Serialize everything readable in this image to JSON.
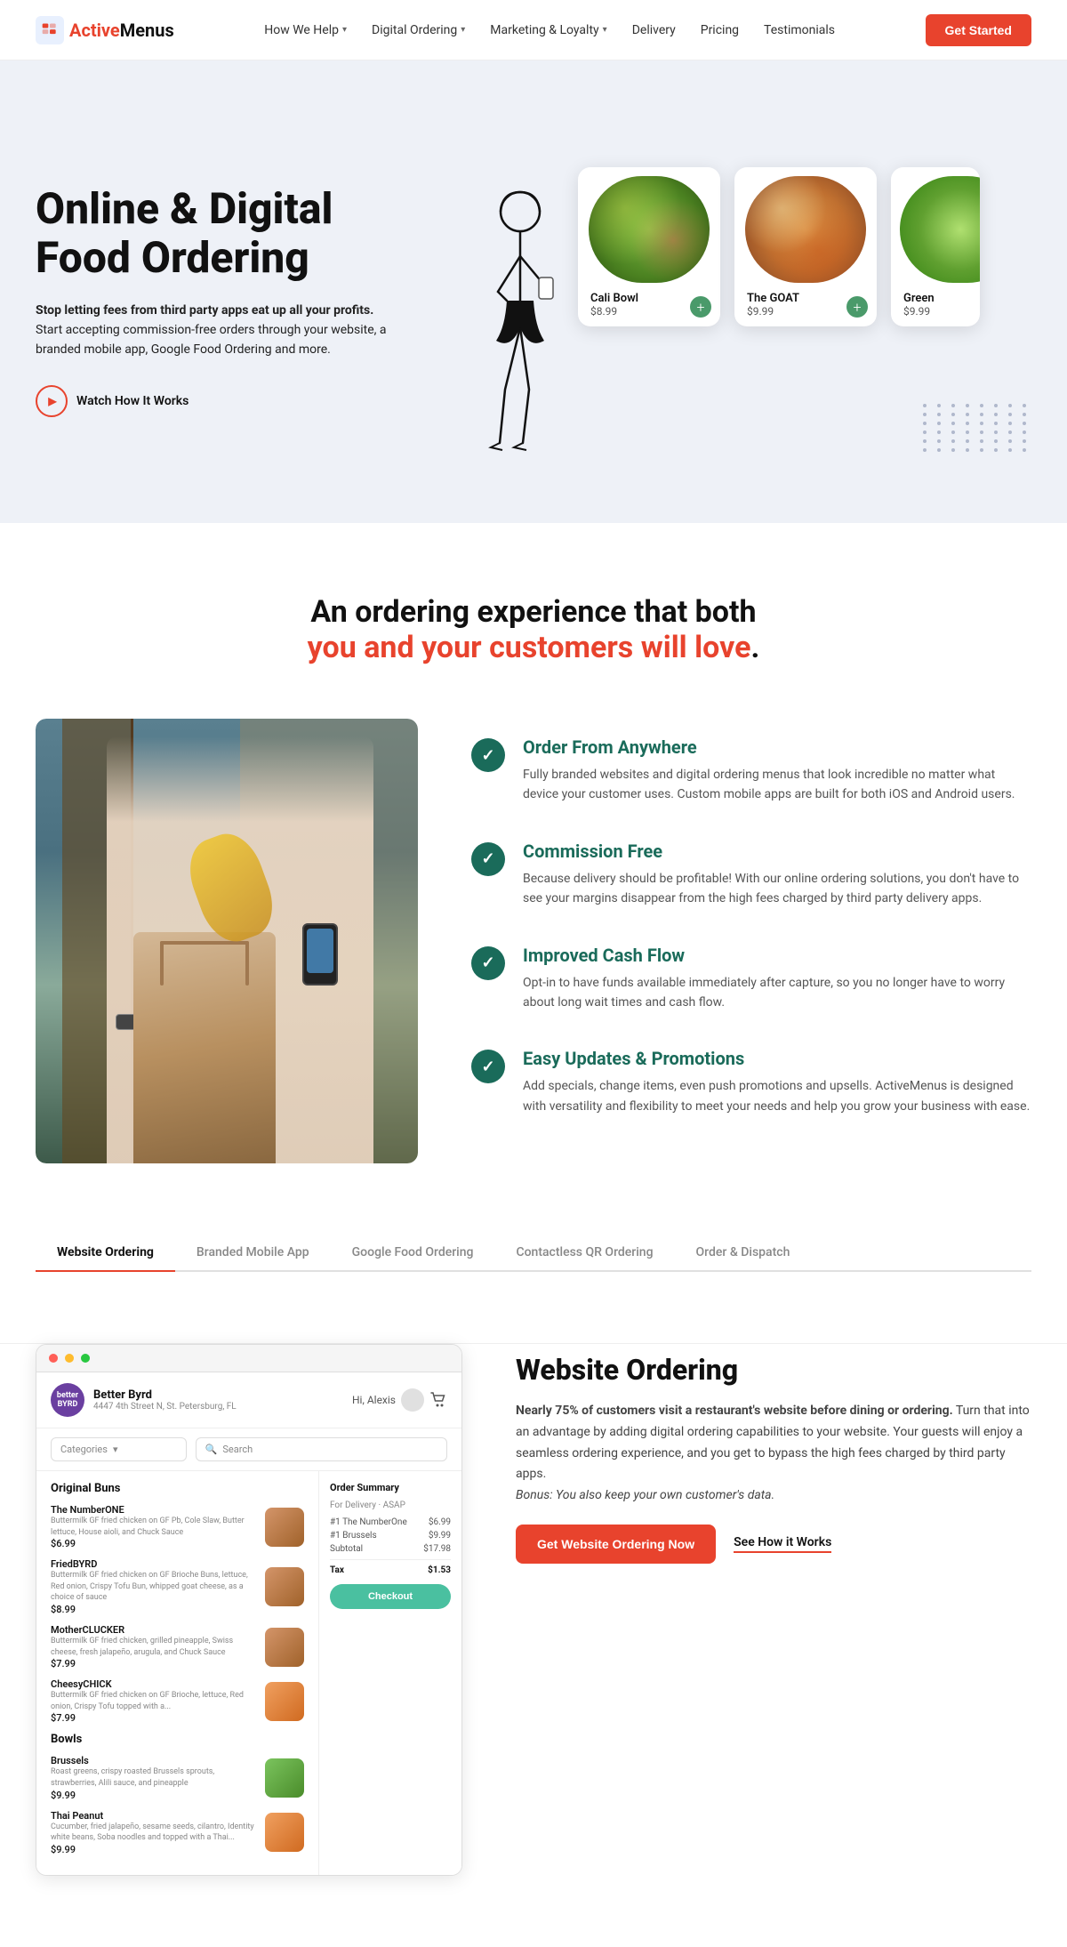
{
  "nav": {
    "logo_active": "Active",
    "logo_rest": "Menus",
    "links": [
      {
        "id": "how-we-help",
        "label": "How We Help",
        "has_dropdown": true
      },
      {
        "id": "digital-ordering",
        "label": "Digital Ordering",
        "has_dropdown": true
      },
      {
        "id": "marketing-loyalty",
        "label": "Marketing & Loyalty",
        "has_dropdown": true
      },
      {
        "id": "delivery",
        "label": "Delivery",
        "has_dropdown": false
      },
      {
        "id": "pricing",
        "label": "Pricing",
        "has_dropdown": false
      },
      {
        "id": "testimonials",
        "label": "Testimonials",
        "has_dropdown": false
      }
    ],
    "cta_label": "Get Started"
  },
  "hero": {
    "title": "Online & Digital Food Ordering",
    "subtitle_bold": "Stop letting fees from third party apps eat up all your profits.",
    "subtitle_normal": "Start accepting commission-free orders through your website, a branded mobile app, Google Food Ordering and more.",
    "watch_label": "Watch How It Works",
    "food_items": [
      {
        "name": "Cali Bowl",
        "price": "$8.99"
      },
      {
        "name": "The GOAT",
        "price": "$9.99"
      },
      {
        "name": "Green",
        "price": "$9.99"
      }
    ]
  },
  "tagline": {
    "line1": "An ordering experience that both",
    "line2": "you and your customers will love",
    "dot": "."
  },
  "features": {
    "items": [
      {
        "id": "order-anywhere",
        "title": "Order From Anywhere",
        "desc": "Fully branded websites and digital ordering menus that look incredible no matter what device your customer uses. Custom mobile apps are built for both iOS and Android users."
      },
      {
        "id": "commission-free",
        "title": "Commission Free",
        "desc": "Because delivery should be profitable! With our online ordering solutions, you don't have to see your margins disappear from the high fees charged by third party delivery apps."
      },
      {
        "id": "improved-cash-flow",
        "title": "Improved Cash Flow",
        "desc": "Opt-in to have funds available immediately after capture, so you no longer have to worry about long wait times and cash flow."
      },
      {
        "id": "easy-updates",
        "title": "Easy Updates & Promotions",
        "desc": "Add specials, change items, even push promotions and upsells. ActiveMenus is designed with versatility and flexibility to meet your needs and help you grow your business with ease."
      }
    ]
  },
  "tabs": {
    "items": [
      {
        "id": "website-ordering",
        "label": "Website Ordering",
        "active": true
      },
      {
        "id": "branded-mobile-app",
        "label": "Branded Mobile App",
        "active": false
      },
      {
        "id": "google-food-ordering",
        "label": "Google Food Ordering",
        "active": false
      },
      {
        "id": "contactless-qr",
        "label": "Contactless QR Ordering",
        "active": false
      },
      {
        "id": "order-dispatch",
        "label": "Order & Dispatch",
        "active": false
      }
    ]
  },
  "demo": {
    "browser": {
      "restaurant_name": "Better Byrd",
      "restaurant_address": "4447 4th Street N, St. Petersburg, FL",
      "user_greeting": "Hi, Alexis",
      "categories_label": "Categories",
      "search_placeholder": "Search",
      "order_summary_title": "Order Summary",
      "order_type": "For Delivery · ASAP",
      "menu_sections": [
        {
          "name": "Original Buns",
          "items": [
            {
              "name": "The NumberONE",
              "desc": "Buttermilk GF fried chicken on GF Pb, Cole Slaw, Butter lettuce, House aioli, and Chuck Sauce",
              "price": "$6.99",
              "img": "burger"
            },
            {
              "name": "FriedBYRD",
              "desc": "Buttermilk GF fried chicken on GF Brioche Buns, lettuce, Red onion, Crispy Tofu Bun, whipped goat cheese, as a choice of sauce",
              "price": "$8.99",
              "img": "burger"
            },
            {
              "name": "MotherCLUCKER",
              "desc": "Buttermilk GF fried chicken, grilled pineapple, Swiss cheese, fresh jalapeño, arugula, and Chuck Sauce",
              "price": "$7.99",
              "img": "burger"
            },
            {
              "name": "CheesyCHICK",
              "desc": "Buttermilk GF fried chicken on GF Brioche, lettuce, Red onion, Crispy Tofu topped with a...",
              "price": "$7.99",
              "img": "orange"
            }
          ]
        },
        {
          "name": "Bowls",
          "items": [
            {
              "name": "Brussels",
              "desc": "Roast greens, crispy roasted Brussels sprouts, strawberries, Alili sauce, and pineapple",
              "price": "$9.99",
              "img": "salad"
            },
            {
              "name": "Thai Peanut",
              "desc": "Cucumber, fried jalapeño, sesame seeds, cilantro, Identity white beans, Soba noodles and topped with a Thai...",
              "price": "$9.99",
              "img": "orange"
            }
          ]
        }
      ],
      "order_lines": [
        {
          "qty": "#1",
          "item": "The NumberOne",
          "price": "$6.99"
        },
        {
          "qty": "#1",
          "item": "Brussels",
          "price": "$9.99"
        }
      ],
      "subtotal_label": "Subtotal",
      "subtotal_value": "$17.98",
      "tax_label": "Tax",
      "tax_value": "$1.53",
      "checkout_label": "Checkout"
    },
    "title": "Website Ordering",
    "desc_bold": "Nearly 75% of customers visit a restaurant's website before dining or ordering.",
    "desc_normal": " Turn that into an advantage by adding digital ordering capabilities to your website. Your guests will enjoy a seamless ordering experience, and you get to bypass the high fees charged by third party apps.",
    "desc_italic": "Bonus: You also keep your own customer's data.",
    "cta_primary": "Get Website Ordering Now",
    "cta_secondary": "See How it Works"
  }
}
